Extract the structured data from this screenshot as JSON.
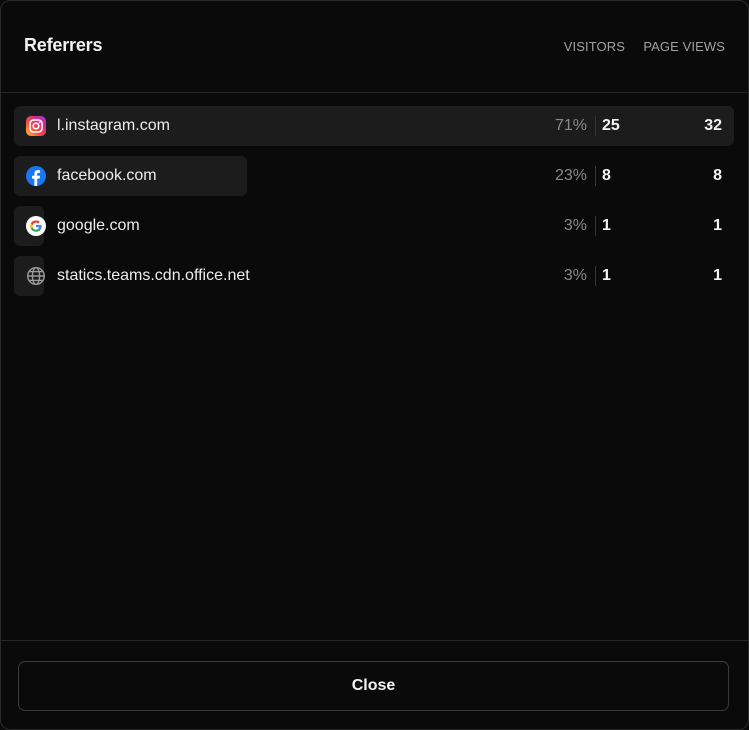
{
  "header": {
    "title": "Referrers",
    "col_visitors": "VISITORS",
    "col_pageviews": "PAGE VIEWS"
  },
  "referrers": [
    {
      "host": "l.instagram.com",
      "icon": "instagram-icon",
      "percent": "71%",
      "share": 0.71,
      "visitors": "25",
      "page_views": "32"
    },
    {
      "host": "facebook.com",
      "icon": "facebook-icon",
      "percent": "23%",
      "share": 0.23,
      "visitors": "8",
      "page_views": "8"
    },
    {
      "host": "google.com",
      "icon": "google-icon",
      "percent": "3%",
      "share": 0.03,
      "visitors": "1",
      "page_views": "1"
    },
    {
      "host": "statics.teams.cdn.office.net",
      "icon": "globe-icon",
      "percent": "3%",
      "share": 0.03,
      "visitors": "1",
      "page_views": "1"
    }
  ],
  "footer": {
    "close_label": "Close"
  }
}
